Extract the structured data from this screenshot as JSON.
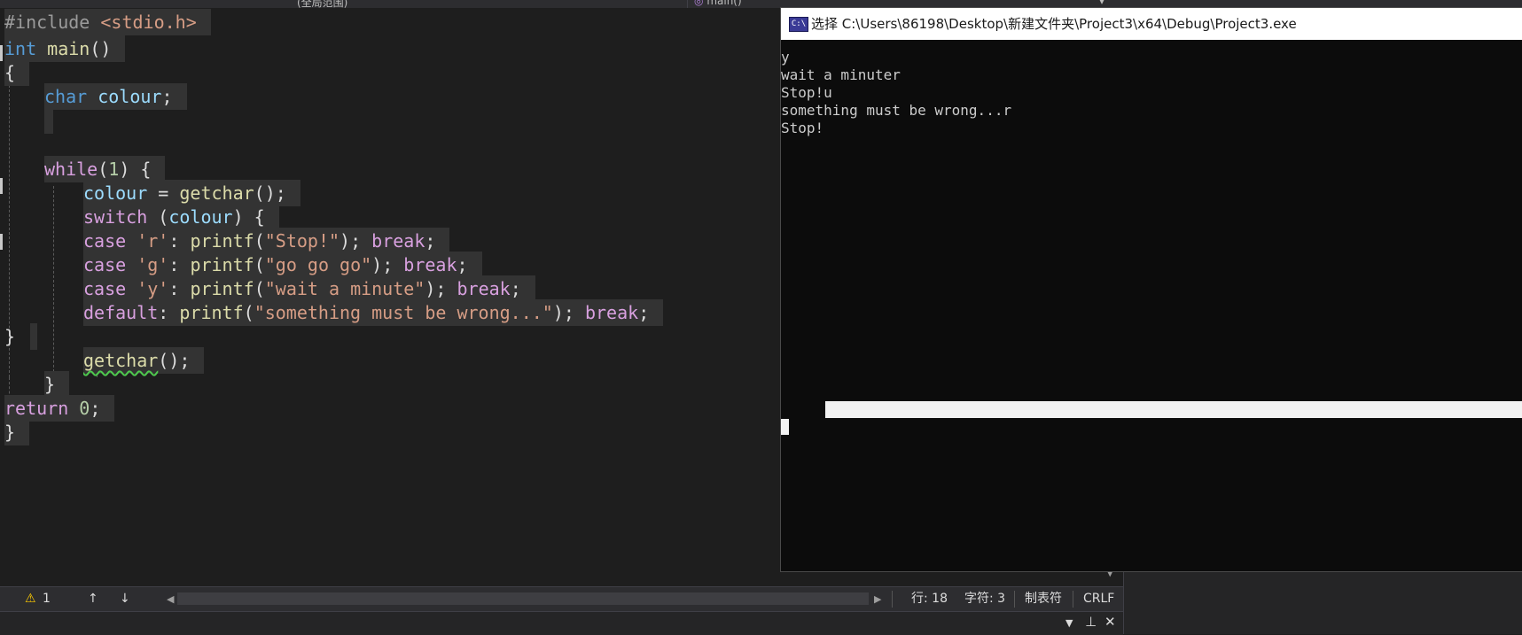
{
  "top_tabs": {
    "left": "(全局范围)",
    "right": "main()"
  },
  "code": {
    "lines": [
      [
        "#include ",
        "<stdio.h>"
      ],
      [
        "int",
        " ",
        "main",
        "()"
      ],
      [
        "{"
      ],
      [
        "char",
        " ",
        "colour",
        ";"
      ],
      [
        "while",
        "(",
        "1",
        ") {"
      ],
      [
        "colour",
        " = ",
        "getchar",
        "();"
      ],
      [
        "switch",
        " (",
        "colour",
        ") {"
      ],
      [
        "case",
        " ",
        "'r'",
        ": ",
        "printf",
        "(",
        "\"Stop!\"",
        "); ",
        "break",
        ";"
      ],
      [
        "case",
        " ",
        "'g'",
        ": ",
        "printf",
        "(",
        "\"go go go\"",
        "); ",
        "break",
        ";"
      ],
      [
        "case",
        " ",
        "'y'",
        ": ",
        "printf",
        "(",
        "\"wait a minute\"",
        "); ",
        "break",
        ";"
      ],
      [
        "default",
        ": ",
        "printf",
        "(",
        "\"something must be wrong...\"",
        "); ",
        "break",
        ";"
      ],
      [
        "}"
      ],
      [
        "getchar",
        "();"
      ],
      [
        "}"
      ],
      [
        "return",
        " ",
        "0",
        ";"
      ],
      [
        "}"
      ]
    ]
  },
  "status": {
    "warnings": "1",
    "warning_icon": "warning-triangle-icon",
    "up_icon": "arrow-up-icon",
    "down_icon": "arrow-down-icon",
    "line": "行: 18",
    "char": "字符: 3",
    "tabs": "制表符",
    "eol": "CRLF"
  },
  "panel": {
    "dropdown_icon": "chevron-down-icon",
    "pin_icon": "pin-icon",
    "close_icon": "close-icon"
  },
  "console": {
    "title": "选择 C:\\Users\\86198\\Desktop\\新建文件夹\\Project3\\x64\\Debug\\Project3.exe",
    "icon_text": "C:\\",
    "output": [
      "y",
      "wait a minuter",
      "Stop!u",
      "something must be wrong...r",
      "Stop!"
    ]
  },
  "colors": {
    "editor_bg": "#1e1e1e",
    "selection": "#333333",
    "keyword_blue": "#569cd6",
    "keyword_purple": "#d8a0df",
    "function": "#dcdcaa",
    "variable": "#9cdcfe",
    "string": "#d69d85",
    "number": "#b5cea8",
    "console_bg": "#0c0c0c"
  }
}
